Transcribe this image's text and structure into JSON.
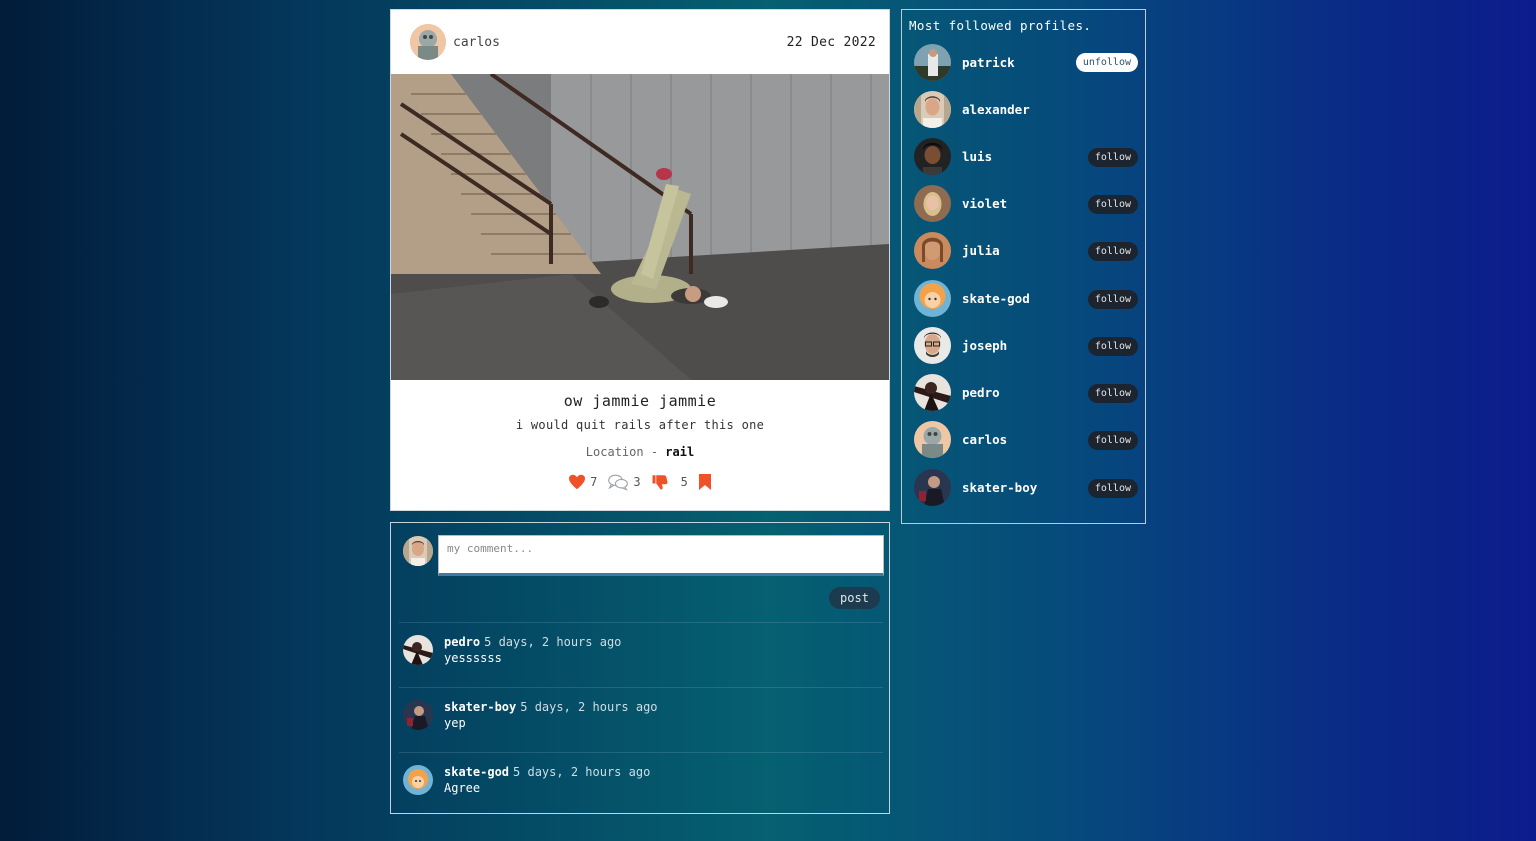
{
  "post": {
    "author": "carlos",
    "date": "22 Dec 2022",
    "title": "ow jammie jammie",
    "description": "i would quit rails after this one",
    "location_label": "Location -",
    "location_value": "rail",
    "likes": "7",
    "comments": "3",
    "dislikes": "5"
  },
  "comment_form": {
    "placeholder": "my comment...",
    "post_label": "post"
  },
  "comments": [
    {
      "user": "pedro",
      "time": "5 days, 2 hours ago",
      "text": "yessssss"
    },
    {
      "user": "skater-boy",
      "time": "5 days, 2 hours ago",
      "text": "yep"
    },
    {
      "user": "skate-god",
      "time": "5 days, 2 hours ago",
      "text": "Agree"
    }
  ],
  "profiles": {
    "title": "Most followed profiles.",
    "items": [
      {
        "name": "patrick",
        "button": "unfollow"
      },
      {
        "name": "alexander",
        "button": ""
      },
      {
        "name": "luis",
        "button": "follow"
      },
      {
        "name": "violet",
        "button": "follow"
      },
      {
        "name": "julia",
        "button": "follow"
      },
      {
        "name": "skate-god",
        "button": "follow"
      },
      {
        "name": "joseph",
        "button": "follow"
      },
      {
        "name": "pedro",
        "button": "follow"
      },
      {
        "name": "carlos",
        "button": "follow"
      },
      {
        "name": "skater-boy",
        "button": "follow"
      }
    ]
  },
  "icons": {
    "like": "heart-icon",
    "comment": "comment-bubbles-icon",
    "dislike": "thumbs-down-icon",
    "save": "bookmark-icon"
  },
  "colors": {
    "accent": "#f0502a",
    "button_dark": "#1c2430",
    "card": "#ffffff"
  }
}
